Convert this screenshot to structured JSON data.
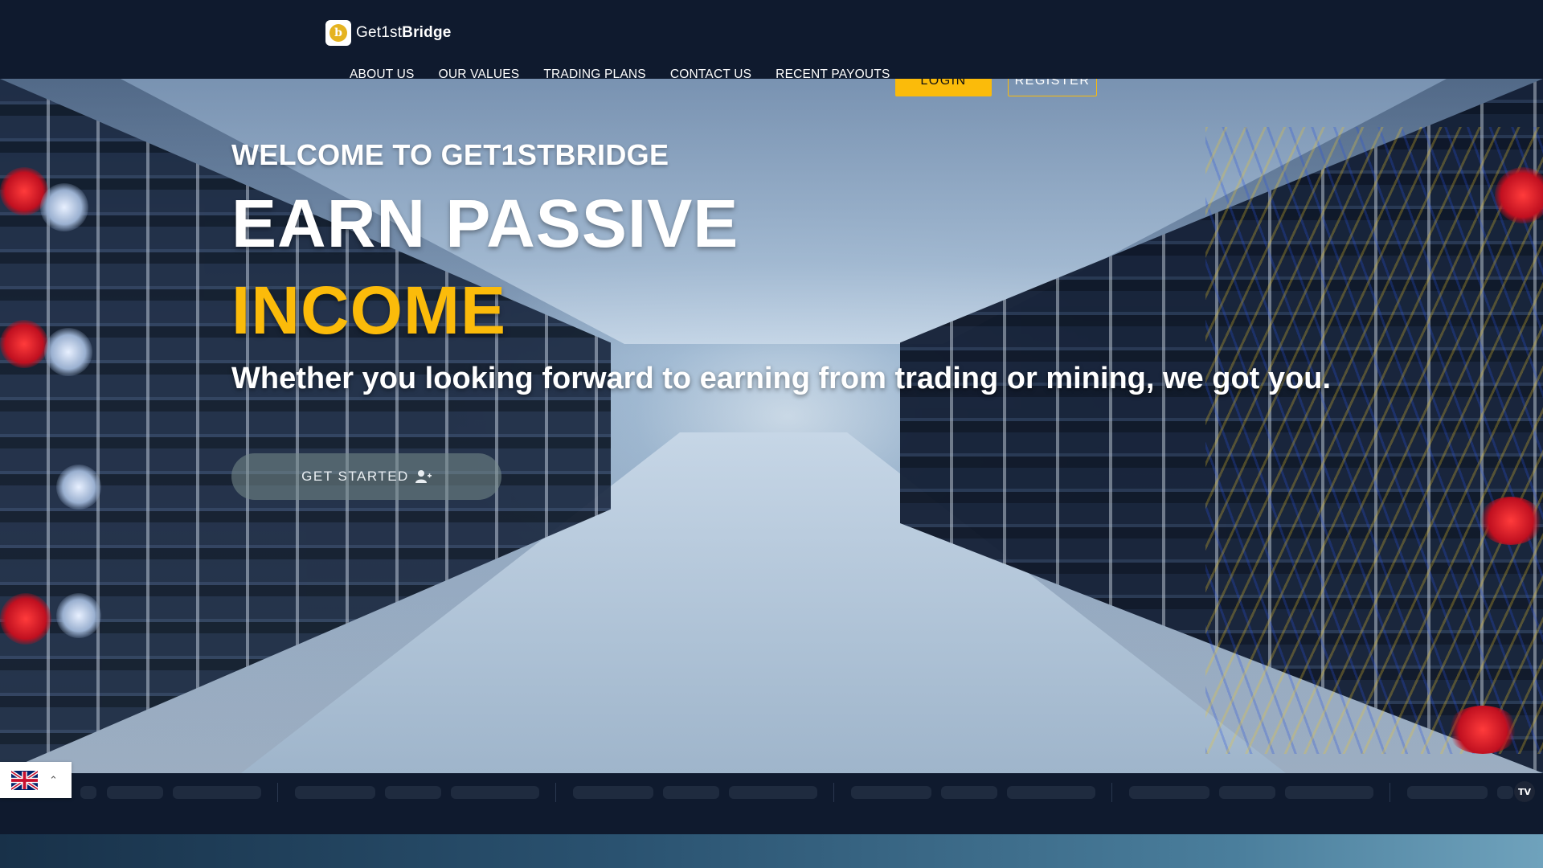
{
  "brand": {
    "name_light": "Get1st",
    "name_bold": "Bridge",
    "logo_glyph": "b"
  },
  "nav": {
    "items": [
      {
        "label": "ABOUT US"
      },
      {
        "label": "OUR VALUES"
      },
      {
        "label": "TRADING PLANS"
      },
      {
        "label": "CONTACT US"
      },
      {
        "label": "RECENT PAYOUTS"
      }
    ],
    "login_label": "LOGIN",
    "register_label": "REGISTER"
  },
  "hero": {
    "welcome": "WELCOME TO GET1STBRIDGE",
    "headline_line1": "EARN PASSIVE",
    "headline_line2": "INCOME",
    "tagline": "Whether you looking forward to earning from trading or mining, we got you.",
    "cta_label": "GET STARTED",
    "cta_icon": "user-plus-icon"
  },
  "ticker": {
    "badge": "TV"
  },
  "language": {
    "selected_flag": "uk-flag-icon"
  },
  "colors": {
    "background": "#0f1a2e",
    "accent": "#fbbb0a",
    "text": "#ffffff"
  }
}
